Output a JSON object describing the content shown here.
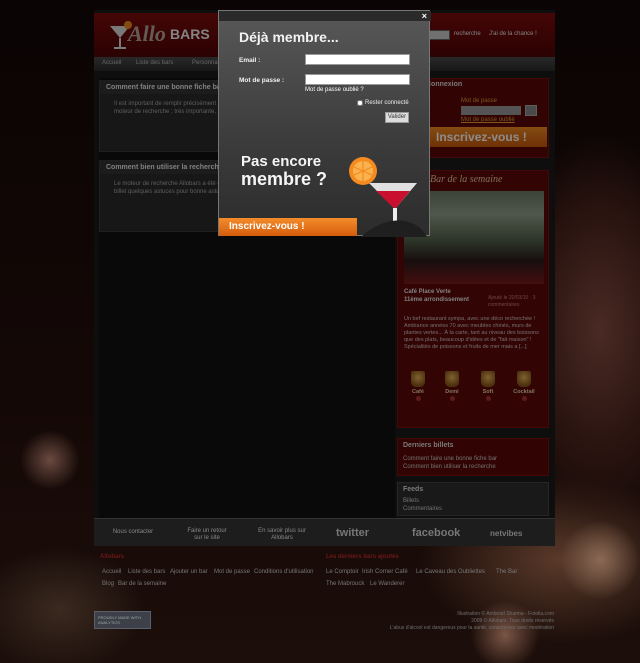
{
  "header": {
    "logo_script": "Allo",
    "logo_bars": "BARS",
    "search_button": "recherche",
    "lucky_link": "J'ai de la chance !"
  },
  "nav": [
    "Accueil",
    "Liste des bars",
    "Personnaliser"
  ],
  "posts": [
    {
      "title": "Comment faire une bonne fiche bar",
      "body": "Il est important de remplir précisément la fiche d'un bar, afin qu'on puisse retrouver le bar sur le moteur de recherche ; très importante, et doit rester la plus objective…"
    },
    {
      "title": "Comment bien utiliser la recherche",
      "body": "Le moteur de recherche Allobars a été conçu pour vous aider à chercher. Vous trouverez dans ce billet quelques astuces pour bonne astuce. […]"
    }
  ],
  "sidebar": {
    "login_title": "Connexion",
    "password_label": "Mot de passe",
    "forgot_link": "Mot de passe oublié",
    "signup_button": "Inscrivez-vous !",
    "week_title": "Bar de la semaine",
    "bar_name": "Café Place Verte",
    "bar_district": "11ème arrondissement",
    "bar_meta": "Ajouté le 20/03/10 · 3 commentaires",
    "bar_description": "Un bef restaurant sympa, avec une déco recherchée ! Ambiance années 70 avec meubles chinés, murs de plantes vertes... À la carte, tant au niveau des boissons que des plats, beaucoup d'idées et de \"fait maison\" ! Spécialités de poissons et fruits de mer mais a [...]",
    "drinks": [
      "Café",
      "Demi",
      "Soft",
      "Cocktail"
    ],
    "posts_title": "Derniers billets",
    "posts_links": [
      "Comment faire une bonne fiche bar",
      "Comment bien utiliser la recherche"
    ],
    "feeds_title": "Feeds",
    "feeds_links": [
      "Billets",
      "Commentaires"
    ]
  },
  "footer": {
    "top_items": [
      "Nous contacter",
      "Faire un retour sur le site",
      "En savoir plus sur Allobars"
    ],
    "social": [
      "twitter",
      "facebook",
      "netvibes"
    ],
    "left_heading": "Allobars",
    "left_links": [
      "Accueil",
      "Liste des bars",
      "Ajouter un bar",
      "Mot de passe",
      "Conditions d'utilisation",
      "Blog",
      "Bar de la semaine"
    ],
    "right_heading": "Les derniers bars ajoutés",
    "right_links": [
      "Le Comptoir",
      "Irish Corner Café",
      "Le Caveau des Oubliettes",
      "The Bar",
      "The Mabrouck",
      "Le Wanderer"
    ],
    "badge": "PROUDLY MADE WITH ANALYTICS",
    "credits": [
      "Illustration © Ambroid Sharma - Fotolia.com",
      "2009 © Allobars. Tous droits réservés",
      "L'abus d'alcool est dangereux pour la santé, consommez avec modération"
    ]
  },
  "modal": {
    "close": "×",
    "title": "Déjà membre...",
    "email_label": "Email :",
    "email_value": "",
    "password_label": "Mot de passe :",
    "password_value": "",
    "forgot": "Mot de passe oublié ?",
    "remember": "Rester connecté",
    "validate": "Valider",
    "join_line1": "Pas encore",
    "join_line2": "membre ?",
    "signup": "Inscrivez-vous !"
  },
  "colors": {
    "brand_red": "#6a0a0a",
    "accent_orange": "#f07f1c",
    "modal_gray": "#4a4a4a"
  }
}
